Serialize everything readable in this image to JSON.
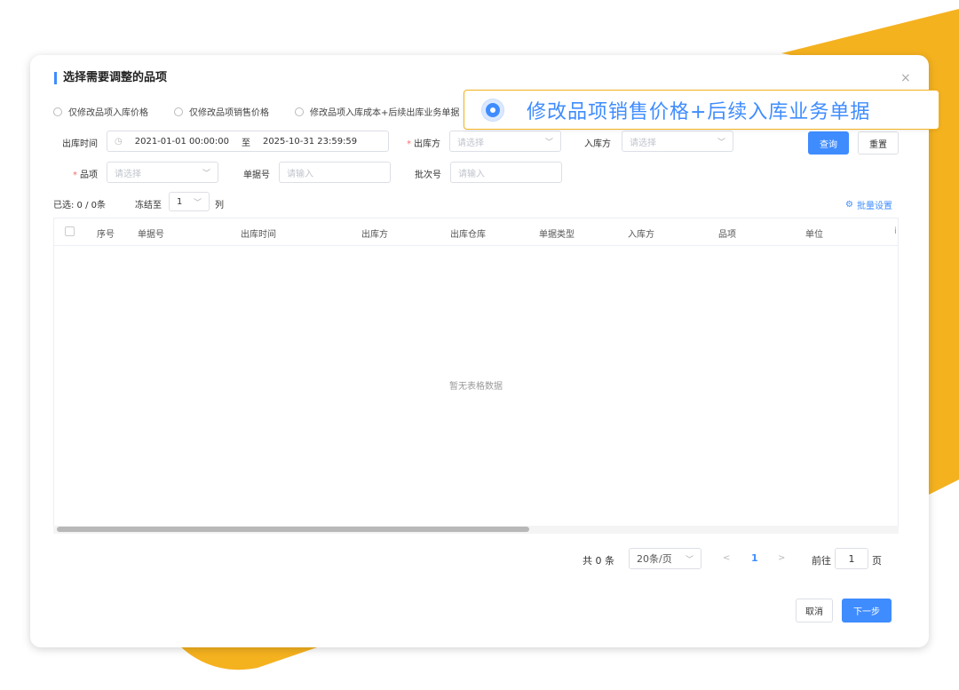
{
  "dialog": {
    "title": "选择需要调整的品项",
    "close_label": "×"
  },
  "radios": [
    {
      "label": "仅修改品项入库价格"
    },
    {
      "label": "仅修改品项销售价格"
    },
    {
      "label": "修改品项入库成本+后续出库业务单据"
    }
  ],
  "callout": {
    "label": "修改品项销售价格+后续入库业务单据"
  },
  "filters": {
    "out_time_label": "出库时间",
    "date_start": "2021-01-01 00:00:00",
    "date_sep": "至",
    "date_end": "2025-10-31 23:59:59",
    "out_party_label": "出库方",
    "out_party_placeholder": "请选择",
    "in_party_label": "入库方",
    "in_party_placeholder": "请选择",
    "item_label": "品项",
    "item_placeholder": "请选择",
    "doc_no_label": "单据号",
    "doc_no_placeholder": "请输入",
    "batch_label": "批次号",
    "batch_placeholder": "请输入",
    "query_button": "查询",
    "reset_button": "重置"
  },
  "selection": {
    "selected_text": "已选: 0 / 0条",
    "freeze_label": "冻结至",
    "freeze_value": "1",
    "freeze_suffix": "列",
    "batch_setting": "批量设置"
  },
  "table": {
    "columns": [
      "序号",
      "单据号",
      "出库时间",
      "出库方",
      "出库仓库",
      "单据类型",
      "入库方",
      "品项",
      "单位",
      "i"
    ],
    "empty_text": "暂无表格数据"
  },
  "pagination": {
    "total": "共 0 条",
    "page_size": "20条/页",
    "prev": "<",
    "current": "1",
    "next": ">",
    "goto_label": "前往",
    "goto_value": "1",
    "goto_suffix": "页"
  },
  "footer": {
    "cancel": "取消",
    "next": "下一步"
  },
  "colors": {
    "accent": "#3f8cff",
    "background_shape": "#f5b21f"
  }
}
